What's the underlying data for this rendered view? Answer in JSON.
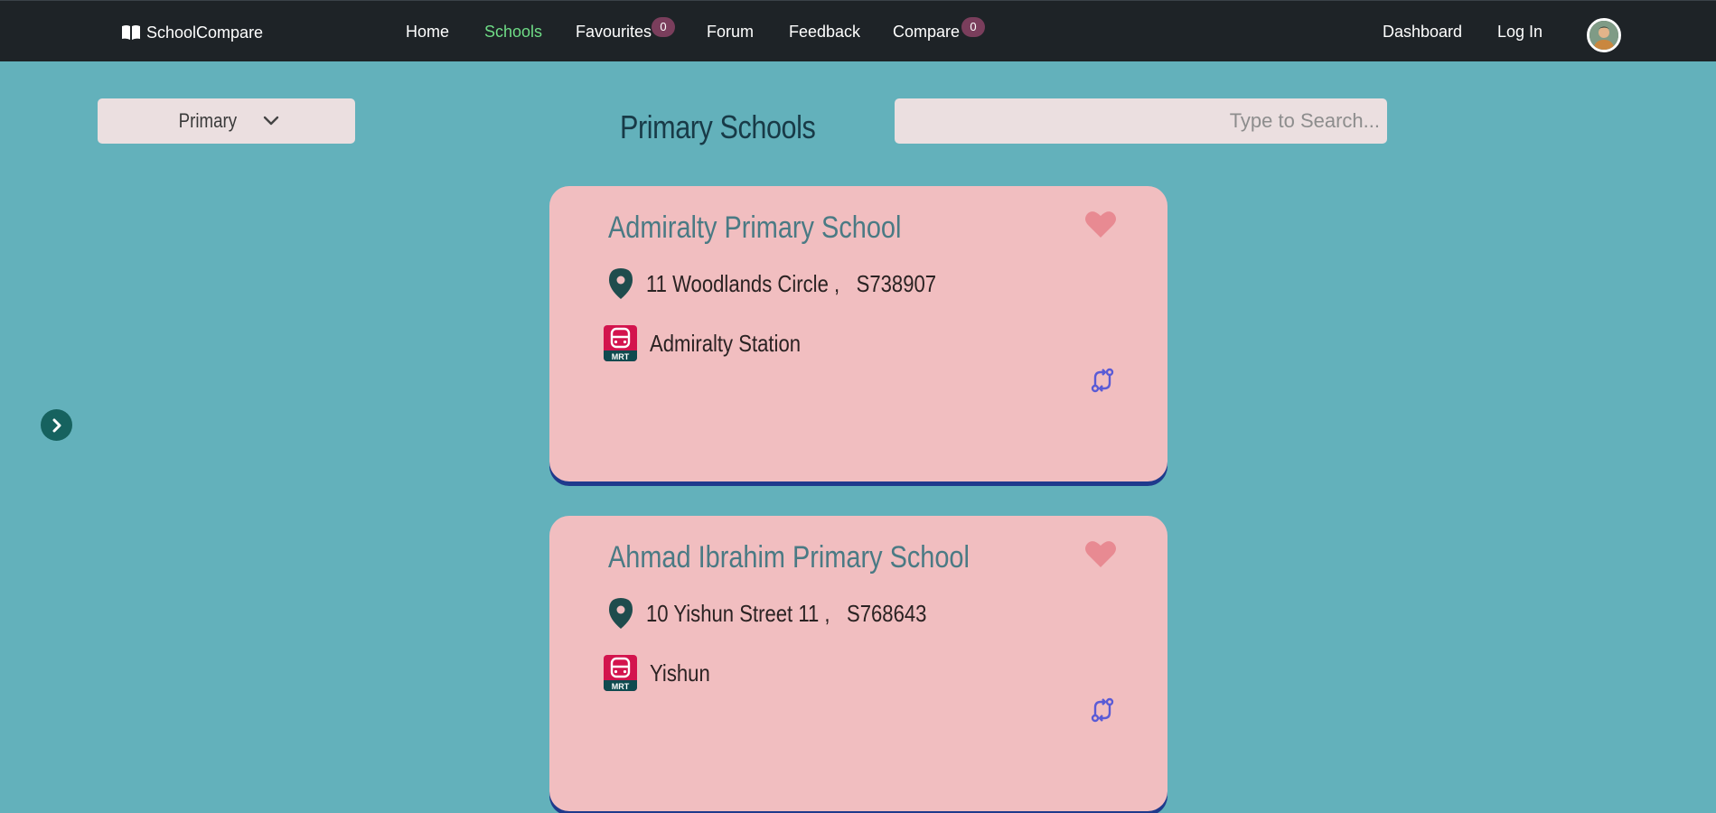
{
  "nav": {
    "brand": "SchoolCompare",
    "links": [
      {
        "label": "Home"
      },
      {
        "label": "Schools",
        "active": true
      },
      {
        "label": "Favourites",
        "badge": "0"
      },
      {
        "label": "Forum"
      },
      {
        "label": "Feedback"
      },
      {
        "label": "Compare",
        "badge": "0"
      }
    ],
    "right_links": [
      {
        "label": "Dashboard"
      },
      {
        "label": "Log In"
      }
    ]
  },
  "filter": {
    "level": "Primary"
  },
  "page_title": "Primary Schools",
  "search": {
    "placeholder": "Type to Search..."
  },
  "schools": [
    {
      "name": "Admiralty Primary School",
      "address": "11 Woodlands Circle ,",
      "postal": "S738907",
      "mrt": "Admiralty Station"
    },
    {
      "name": "Ahmad Ibrahim Primary School",
      "address": "10 Yishun Street 11 ,",
      "postal": "S768643",
      "mrt": "Yishun"
    }
  ],
  "mrt_label": "MRT",
  "colors": {
    "background": "#63b1bb",
    "navbar": "#1e2327",
    "active_link": "#6fdc86",
    "card": "#f1bec0",
    "card_title": "#4a7a84",
    "heart": "#e88a92",
    "compare_icon": "#5a5bd6",
    "badge": "#7a3e5c"
  },
  "icons": [
    "book-icon",
    "chevron-down-icon",
    "chevron-right-icon",
    "heart-icon",
    "location-pin-icon",
    "mrt-train-icon",
    "compare-icon"
  ]
}
